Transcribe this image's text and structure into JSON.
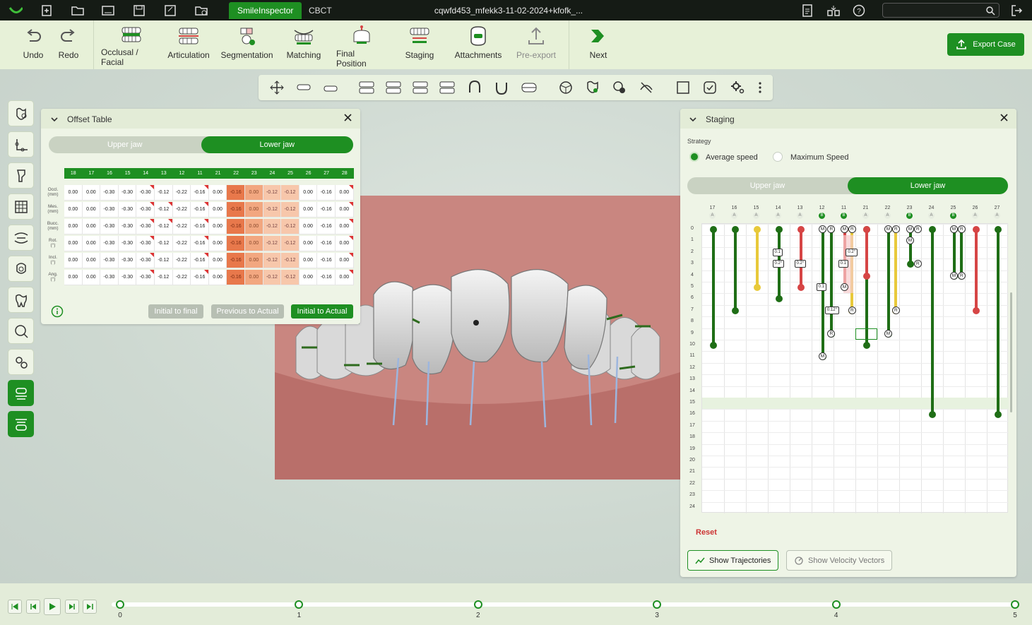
{
  "titlebar": {
    "tabs": [
      "SmileInspector",
      "CBCT"
    ],
    "file_title": "cqwfd453_mfekk3-11-02-2024+kfofk_...",
    "search_placeholder": ""
  },
  "toolbar": {
    "tools": [
      {
        "label": "Undo",
        "icon": "undo-icon"
      },
      {
        "label": "Redo",
        "icon": "redo-icon"
      },
      {
        "label": "Occlusal / Facial",
        "icon": "occlusal-facial-icon"
      },
      {
        "label": "Articulation",
        "icon": "articulation-icon"
      },
      {
        "label": "Segmentation",
        "icon": "segmentation-icon"
      },
      {
        "label": "Matching",
        "icon": "matching-icon"
      },
      {
        "label": "Final Position",
        "icon": "final-position-icon"
      },
      {
        "label": "Staging",
        "icon": "staging-icon"
      },
      {
        "label": "Attachments",
        "icon": "attachments-icon"
      },
      {
        "label": "Pre-export",
        "icon": "pre-export-icon"
      },
      {
        "label": "Next",
        "icon": "next-icon"
      }
    ],
    "export_label": "Export Case"
  },
  "offset_table": {
    "title": "Offset Table",
    "jaw_tabs": [
      "Upper jaw",
      "Lower jaw"
    ],
    "active_jaw": "Lower jaw",
    "teeth": [
      "18",
      "17",
      "16",
      "15",
      "14",
      "13",
      "12",
      "11",
      "21",
      "22",
      "23",
      "24",
      "25",
      "26",
      "27",
      "28"
    ],
    "rows": [
      {
        "label": "Occl.",
        "unit": "(mm)",
        "values": [
          "0.00",
          "0.00",
          "-0.30",
          "-0.30",
          "-0.30",
          "-0.12",
          "-0.22",
          "-0.16",
          "0.00",
          "-0.16",
          "0.00",
          "-0.12",
          "-0.12",
          "0.00",
          "-0.16",
          "0.00"
        ]
      },
      {
        "label": "Mes.",
        "unit": "(mm)",
        "values": [
          "0.00",
          "0.00",
          "-0.30",
          "-0.30",
          "-0.30",
          "-0.12",
          "-0.22",
          "-0.16",
          "0.00",
          "-0.16",
          "0.00",
          "-0.12",
          "-0.12",
          "0.00",
          "-0.16",
          "0.00"
        ]
      },
      {
        "label": "Bucc.",
        "unit": "(mm)",
        "values": [
          "0.00",
          "0.00",
          "-0.30",
          "-0.30",
          "-0.30",
          "-0.12",
          "-0.22",
          "-0.16",
          "0.00",
          "-0.16",
          "0.00",
          "-0.12",
          "-0.12",
          "0.00",
          "-0.16",
          "0.00"
        ]
      },
      {
        "label": "Rot.",
        "unit": "(°)",
        "values": [
          "0.00",
          "0.00",
          "-0.30",
          "-0.30",
          "-0.30",
          "-0.12",
          "-0.22",
          "-0.16",
          "0.00",
          "-0.16",
          "0.00",
          "-0.12",
          "-0.12",
          "0.00",
          "-0.16",
          "0.00"
        ]
      },
      {
        "label": "Incl.",
        "unit": "(°)",
        "values": [
          "0.00",
          "0.00",
          "-0.30",
          "-0.30",
          "-0.30",
          "-0.12",
          "-0.22",
          "-0.16",
          "0.00",
          "-0.16",
          "0.00",
          "-0.12",
          "-0.12",
          "0.00",
          "-0.16",
          "0.00"
        ]
      },
      {
        "label": "Ang.",
        "unit": "(°)",
        "values": [
          "0.00",
          "0.00",
          "-0.30",
          "-0.30",
          "-0.30",
          "-0.12",
          "-0.22",
          "-0.16",
          "0.00",
          "-0.16",
          "0.00",
          "-0.12",
          "-0.12",
          "0.00",
          "-0.16",
          "0.00"
        ]
      }
    ],
    "buttons": [
      "Initial to final",
      "Previous to Actual",
      "Initial to Actual"
    ]
  },
  "staging": {
    "title": "Staging",
    "strategy_label": "Strategy",
    "options": [
      "Average speed",
      "Maximum Speed"
    ],
    "selected_option": "Average speed",
    "jaw_tabs": [
      "Upper jaw",
      "Lower jaw"
    ],
    "active_jaw": "Lower jaw",
    "teeth": [
      "17",
      "16",
      "15",
      "14",
      "13",
      "12",
      "11",
      "21",
      "22",
      "23",
      "24",
      "25",
      "26",
      "27"
    ],
    "sub_labels": [
      "A",
      "A",
      "A",
      "A",
      "A",
      "B",
      "B",
      "A",
      "A",
      "B",
      "A",
      "B",
      "A",
      "A"
    ],
    "stages": [
      "0",
      "1",
      "2",
      "3",
      "4",
      "5",
      "6",
      "7",
      "8",
      "9",
      "10",
      "11",
      "12",
      "13",
      "14",
      "15",
      "16",
      "17",
      "18",
      "19",
      "20",
      "21",
      "22",
      "23",
      "24"
    ],
    "highlight_stage": 15,
    "reset_label": "Reset",
    "show_trajectories": "Show Trajectories",
    "show_velocity": "Show Velocity Vectors",
    "annotations": [
      "0.1",
      "0.2°",
      "0.2°",
      "0.1",
      "0.12°",
      "0.2°",
      "0.1"
    ],
    "status_colors": {
      "green": "#1f6e16",
      "yellow": "#e8c93a",
      "red": "#d64545"
    }
  },
  "timeline": {
    "markers": [
      "0",
      "1",
      "2",
      "3",
      "4",
      "5"
    ]
  },
  "colors": {
    "accent": "#1e8f22",
    "titlebar": "#151b15",
    "toolbar": "#e7f1d8"
  }
}
